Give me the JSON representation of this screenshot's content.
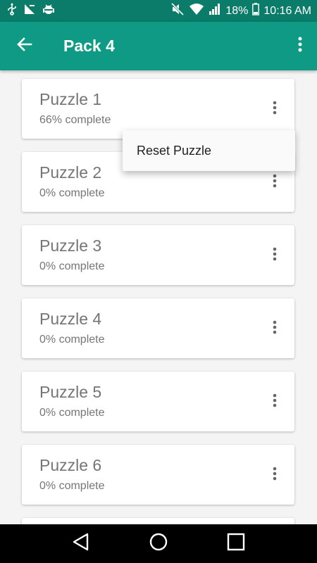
{
  "status_bar": {
    "battery": "18%",
    "time": "10:16 AM",
    "icons": [
      "usb-icon",
      "signal-relay-icon",
      "android-debug-icon",
      "mute-icon",
      "wifi-icon",
      "cell-signal-icon",
      "battery-icon"
    ]
  },
  "app_bar": {
    "title": "Pack 4",
    "back_icon": "arrow-back-icon",
    "overflow_icon": "more-vert-icon"
  },
  "puzzles": [
    {
      "title": "Puzzle 1",
      "progress": "66% complete"
    },
    {
      "title": "Puzzle 2",
      "progress": "0% complete"
    },
    {
      "title": "Puzzle 3",
      "progress": "0% complete"
    },
    {
      "title": "Puzzle 4",
      "progress": "0% complete"
    },
    {
      "title": "Puzzle 5",
      "progress": "0% complete"
    },
    {
      "title": "Puzzle 6",
      "progress": "0% complete"
    }
  ],
  "popup_menu": {
    "items": [
      "Reset Puzzle"
    ]
  },
  "nav_bar": {
    "icons": [
      "back-triangle-icon",
      "home-circle-icon",
      "recents-square-icon"
    ]
  },
  "colors": {
    "status_bar": "#0b7b6a",
    "app_bar": "#0e9a84",
    "background": "#f4f4f4",
    "card_text": "#757575"
  }
}
